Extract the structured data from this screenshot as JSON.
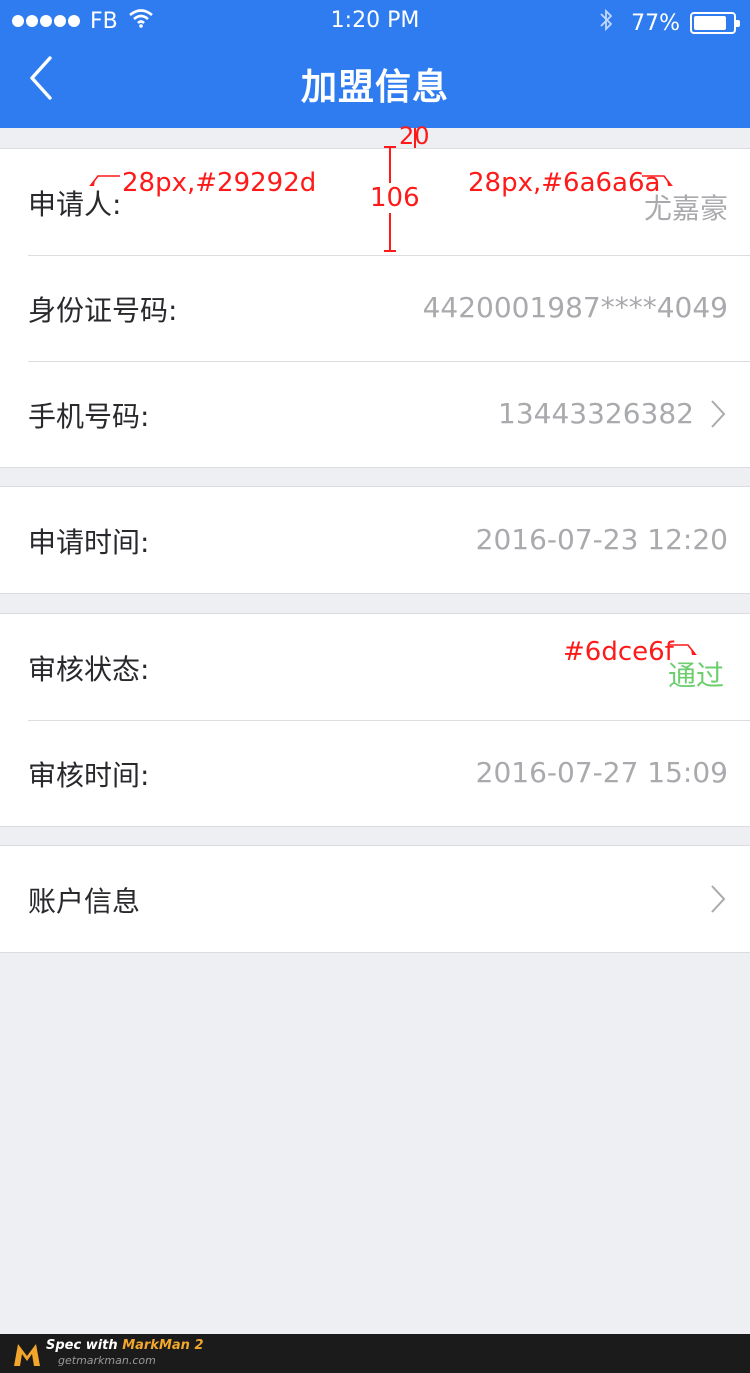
{
  "status_bar": {
    "carrier": "FB",
    "time": "1:20 PM",
    "battery_text": "77%",
    "battery_level": 0.77
  },
  "header": {
    "title": "加盟信息",
    "back_icon": "chevron-left-icon"
  },
  "groups": [
    {
      "rows": [
        {
          "label": "申请人:",
          "value": "尤嘉豪",
          "has_arrow": false
        },
        {
          "label": "身份证号码:",
          "value": "4420001987****4049",
          "has_arrow": false
        },
        {
          "label": "手机号码:",
          "value": "13443326382",
          "has_arrow": true
        }
      ]
    },
    {
      "rows": [
        {
          "label": "申请时间:",
          "value": "2016-07-23  12:20",
          "has_arrow": false
        }
      ]
    },
    {
      "rows": [
        {
          "label": "审核状态:",
          "value": "通过",
          "has_arrow": false,
          "value_color": "#6dce6f"
        },
        {
          "label": "审核时间:",
          "value": "2016-07-27  15:09",
          "has_arrow": false
        }
      ]
    },
    {
      "rows": [
        {
          "label": "账户信息",
          "value": "",
          "has_arrow": true
        }
      ]
    }
  ],
  "annotations": {
    "label_spec": "28px,#29292d",
    "value_spec": "28px,#6a6a6a",
    "row_height": "106",
    "gap": "20",
    "status_color_spec": "#6dce6f"
  },
  "footer": {
    "line1_prefix": "Spec with ",
    "line1_brand": "MarkMan 2",
    "line2": "getmarkman.com"
  },
  "colors": {
    "header_bg": "#2f7cf0",
    "page_bg": "#eeeff3",
    "label": "#29292d",
    "value": "#a9aaad",
    "approved": "#6dce6f",
    "annotation": "#ff1a1a"
  }
}
